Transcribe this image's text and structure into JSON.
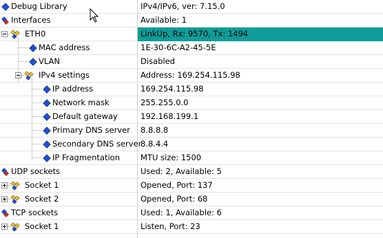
{
  "rows": [
    {
      "name": "Debug Library",
      "value": "IPv4/IPv6, ver: 7.15.0",
      "icon": "diamond-icon"
    },
    {
      "name": "Interfaces",
      "value": "Available: 1",
      "icon": "interfaces-icon"
    },
    {
      "name": "ETH0",
      "value": "LinkUp, Rx: 9570, Tx: 1494",
      "icon": "multi-diamond-icon",
      "expander": "minus",
      "highlight": true
    },
    {
      "name": "MAC address",
      "value": "1E-30-6C-A2-45-5E",
      "icon": "diamond-icon"
    },
    {
      "name": "VLAN",
      "value": "Disabled",
      "icon": "diamond-icon"
    },
    {
      "name": "IPv4 settings",
      "value": "Address: 169.254.115.98",
      "icon": "multi-diamond-icon",
      "expander": "minus"
    },
    {
      "name": "IP address",
      "value": "169.254.115.98",
      "icon": "diamond-icon"
    },
    {
      "name": "Network mask",
      "value": "255.255.0.0",
      "icon": "diamond-icon"
    },
    {
      "name": "Default gateway",
      "value": "192.168.199.1",
      "icon": "diamond-icon"
    },
    {
      "name": "Primary DNS server",
      "value": "8.8.8.8",
      "icon": "diamond-icon"
    },
    {
      "name": "Secondary DNS server",
      "value": "8.8.4.4",
      "icon": "diamond-icon"
    },
    {
      "name": "IP Fragmentation",
      "value": "MTU size: 1500",
      "icon": "diamond-icon"
    },
    {
      "name": "UDP sockets",
      "value": "Used: 2, Available: 5",
      "icon": "interfaces-icon"
    },
    {
      "name": "Socket 1",
      "value": "Opened, Port: 137",
      "icon": "multi-diamond-icon",
      "expander": "plus"
    },
    {
      "name": "Socket 2",
      "value": "Opened, Port: 68",
      "icon": "multi-diamond-icon",
      "expander": "plus"
    },
    {
      "name": "TCP sockets",
      "value": "Used: 1, Available: 6",
      "icon": "interfaces-icon"
    },
    {
      "name": "Socket 1",
      "value": "Listen, Port: 23",
      "icon": "multi-diamond-icon",
      "expander": "plus"
    }
  ],
  "colors": {
    "highlight": "#0e9c98",
    "diamond_blue": "#1f4ed8",
    "diamond_yellow": "#f0c020",
    "diamond_red": "#d03030"
  }
}
